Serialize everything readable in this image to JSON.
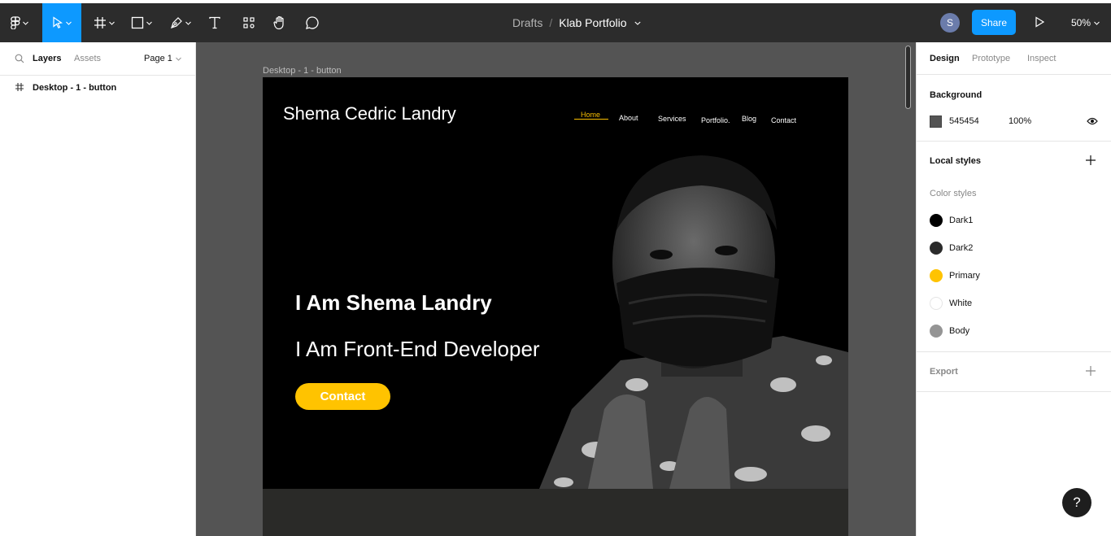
{
  "toolbar": {
    "breadcrumb_drafts": "Drafts",
    "breadcrumb_sep": "/",
    "file_name": "Klab Portfolio",
    "avatar_initial": "S",
    "share_label": "Share",
    "zoom": "50%"
  },
  "layers_panel": {
    "tab_layers": "Layers",
    "tab_assets": "Assets",
    "page": "Page 1",
    "layers": [
      {
        "name": "Desktop - 1 - button"
      }
    ]
  },
  "canvas": {
    "background": "#545454",
    "frame_label": "Desktop - 1 - button",
    "site": {
      "brand": "Shema Cedric Landry",
      "nav": [
        "Home",
        "About",
        "Services",
        "Portfolio.",
        "Blog",
        "Contact"
      ],
      "headline": "I Am Shema Landry",
      "subheadline": "I Am Front-End Developer",
      "cta_label": "Contact",
      "accent_color": "#ffc300"
    }
  },
  "design_panel": {
    "tab_design": "Design",
    "tab_prototype": "Prototype",
    "tab_inspect": "Inspect",
    "background_title": "Background",
    "background_hex": "545454",
    "background_opacity": "100%",
    "local_styles_title": "Local styles",
    "color_styles_title": "Color styles",
    "color_styles": [
      {
        "name": "Dark1",
        "color": "#000000"
      },
      {
        "name": "Dark2",
        "color": "#2b2b2b"
      },
      {
        "name": "Primary",
        "color": "#ffc300"
      },
      {
        "name": "White",
        "color": "#ffffff"
      },
      {
        "name": "Body",
        "color": "#959595"
      }
    ],
    "export_title": "Export"
  },
  "help_label": "?"
}
